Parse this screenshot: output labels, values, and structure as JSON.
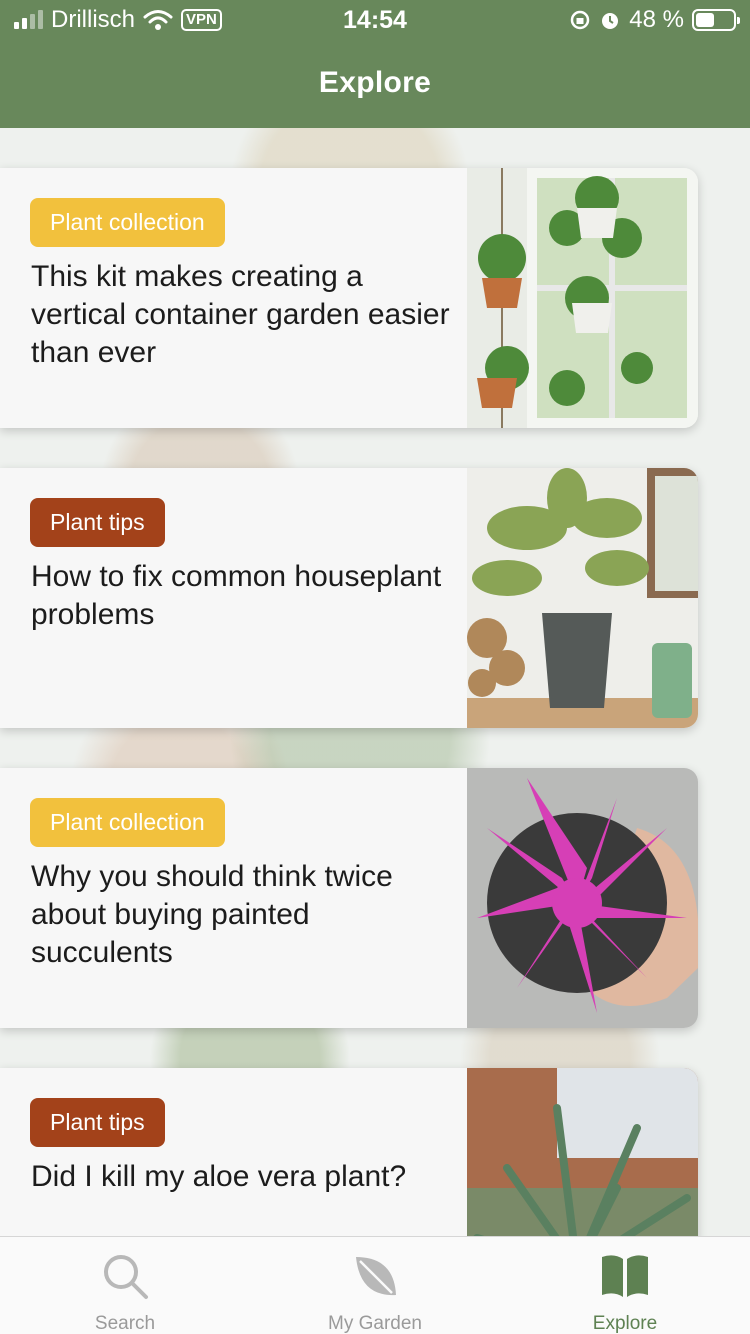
{
  "status_bar": {
    "carrier": "Drillisch",
    "vpn": "VPN",
    "time": "14:54",
    "battery_percent": "48 %",
    "battery_level": 0.48
  },
  "header": {
    "title": "Explore"
  },
  "colors": {
    "brand_green": "#68885b",
    "tag_collection": "#f2c13d",
    "tag_tips": "#a3421a",
    "tab_active": "#5e8152"
  },
  "cards": [
    {
      "tag": "Plant collection",
      "tag_type": "collection",
      "title": "This kit makes creating a vertical container garden easier than ever",
      "image": "hanging-planters-photo"
    },
    {
      "tag": "Plant tips",
      "tag_type": "tips",
      "title": "How to fix common houseplant problems",
      "image": "potted-plant-shelf-photo"
    },
    {
      "tag": "Plant collection",
      "tag_type": "collection",
      "title": "Why you should think twice about buying painted succulents",
      "image": "pink-succulent-photo"
    },
    {
      "tag": "Plant tips",
      "tag_type": "tips",
      "title": "Did I kill my aloe vera plant?",
      "image": "aloe-plant-photo"
    }
  ],
  "tabbar": {
    "search": {
      "label": "Search",
      "icon": "search-icon"
    },
    "garden": {
      "label": "My Garden",
      "icon": "leaf-icon"
    },
    "explore": {
      "label": "Explore",
      "icon": "book-icon",
      "active": true
    }
  }
}
